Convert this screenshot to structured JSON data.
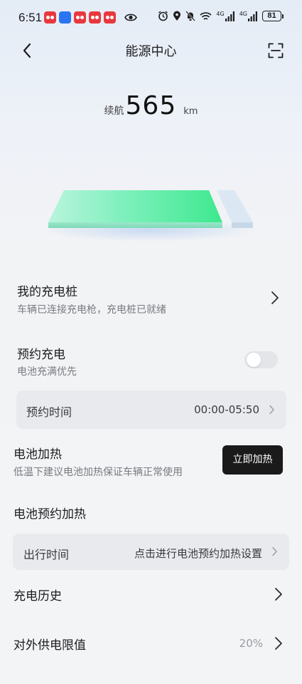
{
  "status_bar": {
    "time": "6:51",
    "net1": "4G",
    "net2": "4G",
    "battery": "81"
  },
  "header": {
    "title": "能源中心"
  },
  "range": {
    "label": "续航",
    "value": "565",
    "unit": "km"
  },
  "battery_level": 0.85,
  "charger": {
    "title": "我的充电桩",
    "subtitle": "车辆已连接充电枪，充电桩已就绪"
  },
  "scheduled_charging": {
    "title": "预约充电",
    "subtitle": "电池充满优先",
    "enabled": false,
    "time_label": "预约时间",
    "time_value": "00:00-05:50"
  },
  "battery_heating": {
    "title": "电池加热",
    "subtitle": "低温下建议电池加热保证车辆正常使用",
    "button_label": "立即加热"
  },
  "battery_preheat": {
    "title": "电池预约加热",
    "trip_label": "出行时间",
    "trip_value": "点击进行电池预约加热设置"
  },
  "charging_history": {
    "title": "充电历史"
  },
  "discharge_limit": {
    "title": "对外供电限值",
    "value": "20%"
  },
  "colors": {
    "accent_green": "#3ee88f",
    "button_dark": "#1a1a1a"
  }
}
